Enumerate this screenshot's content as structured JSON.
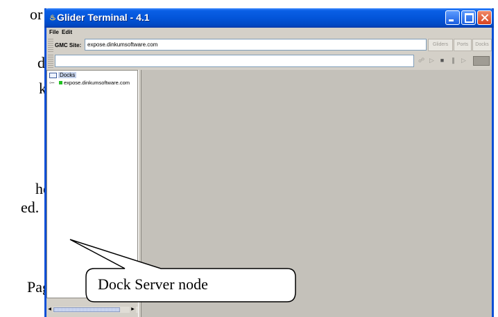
{
  "document": {
    "fragments": [
      "or",
      "d",
      "k",
      "he",
      "ed.",
      "Page"
    ]
  },
  "window": {
    "title": "Glider Terminal - 4.1"
  },
  "menu": {
    "file": "File",
    "edit": "Edit"
  },
  "toolbar": {
    "gmc_label": "GMC Site:",
    "gmc_value": "expose.dinkumsoftware.com",
    "gliders": "Gliders",
    "ports": "Ports",
    "docks": "Docks"
  },
  "tree": {
    "root": "Docks",
    "child": "expose.dinkumsoftware.com"
  },
  "callout": {
    "text": "Dock Server node"
  },
  "colors": {
    "title_bar": "#0355d9",
    "panel": "#d4d0c8",
    "main_area": "#c4c1ba",
    "status_dot": "#22c022"
  }
}
